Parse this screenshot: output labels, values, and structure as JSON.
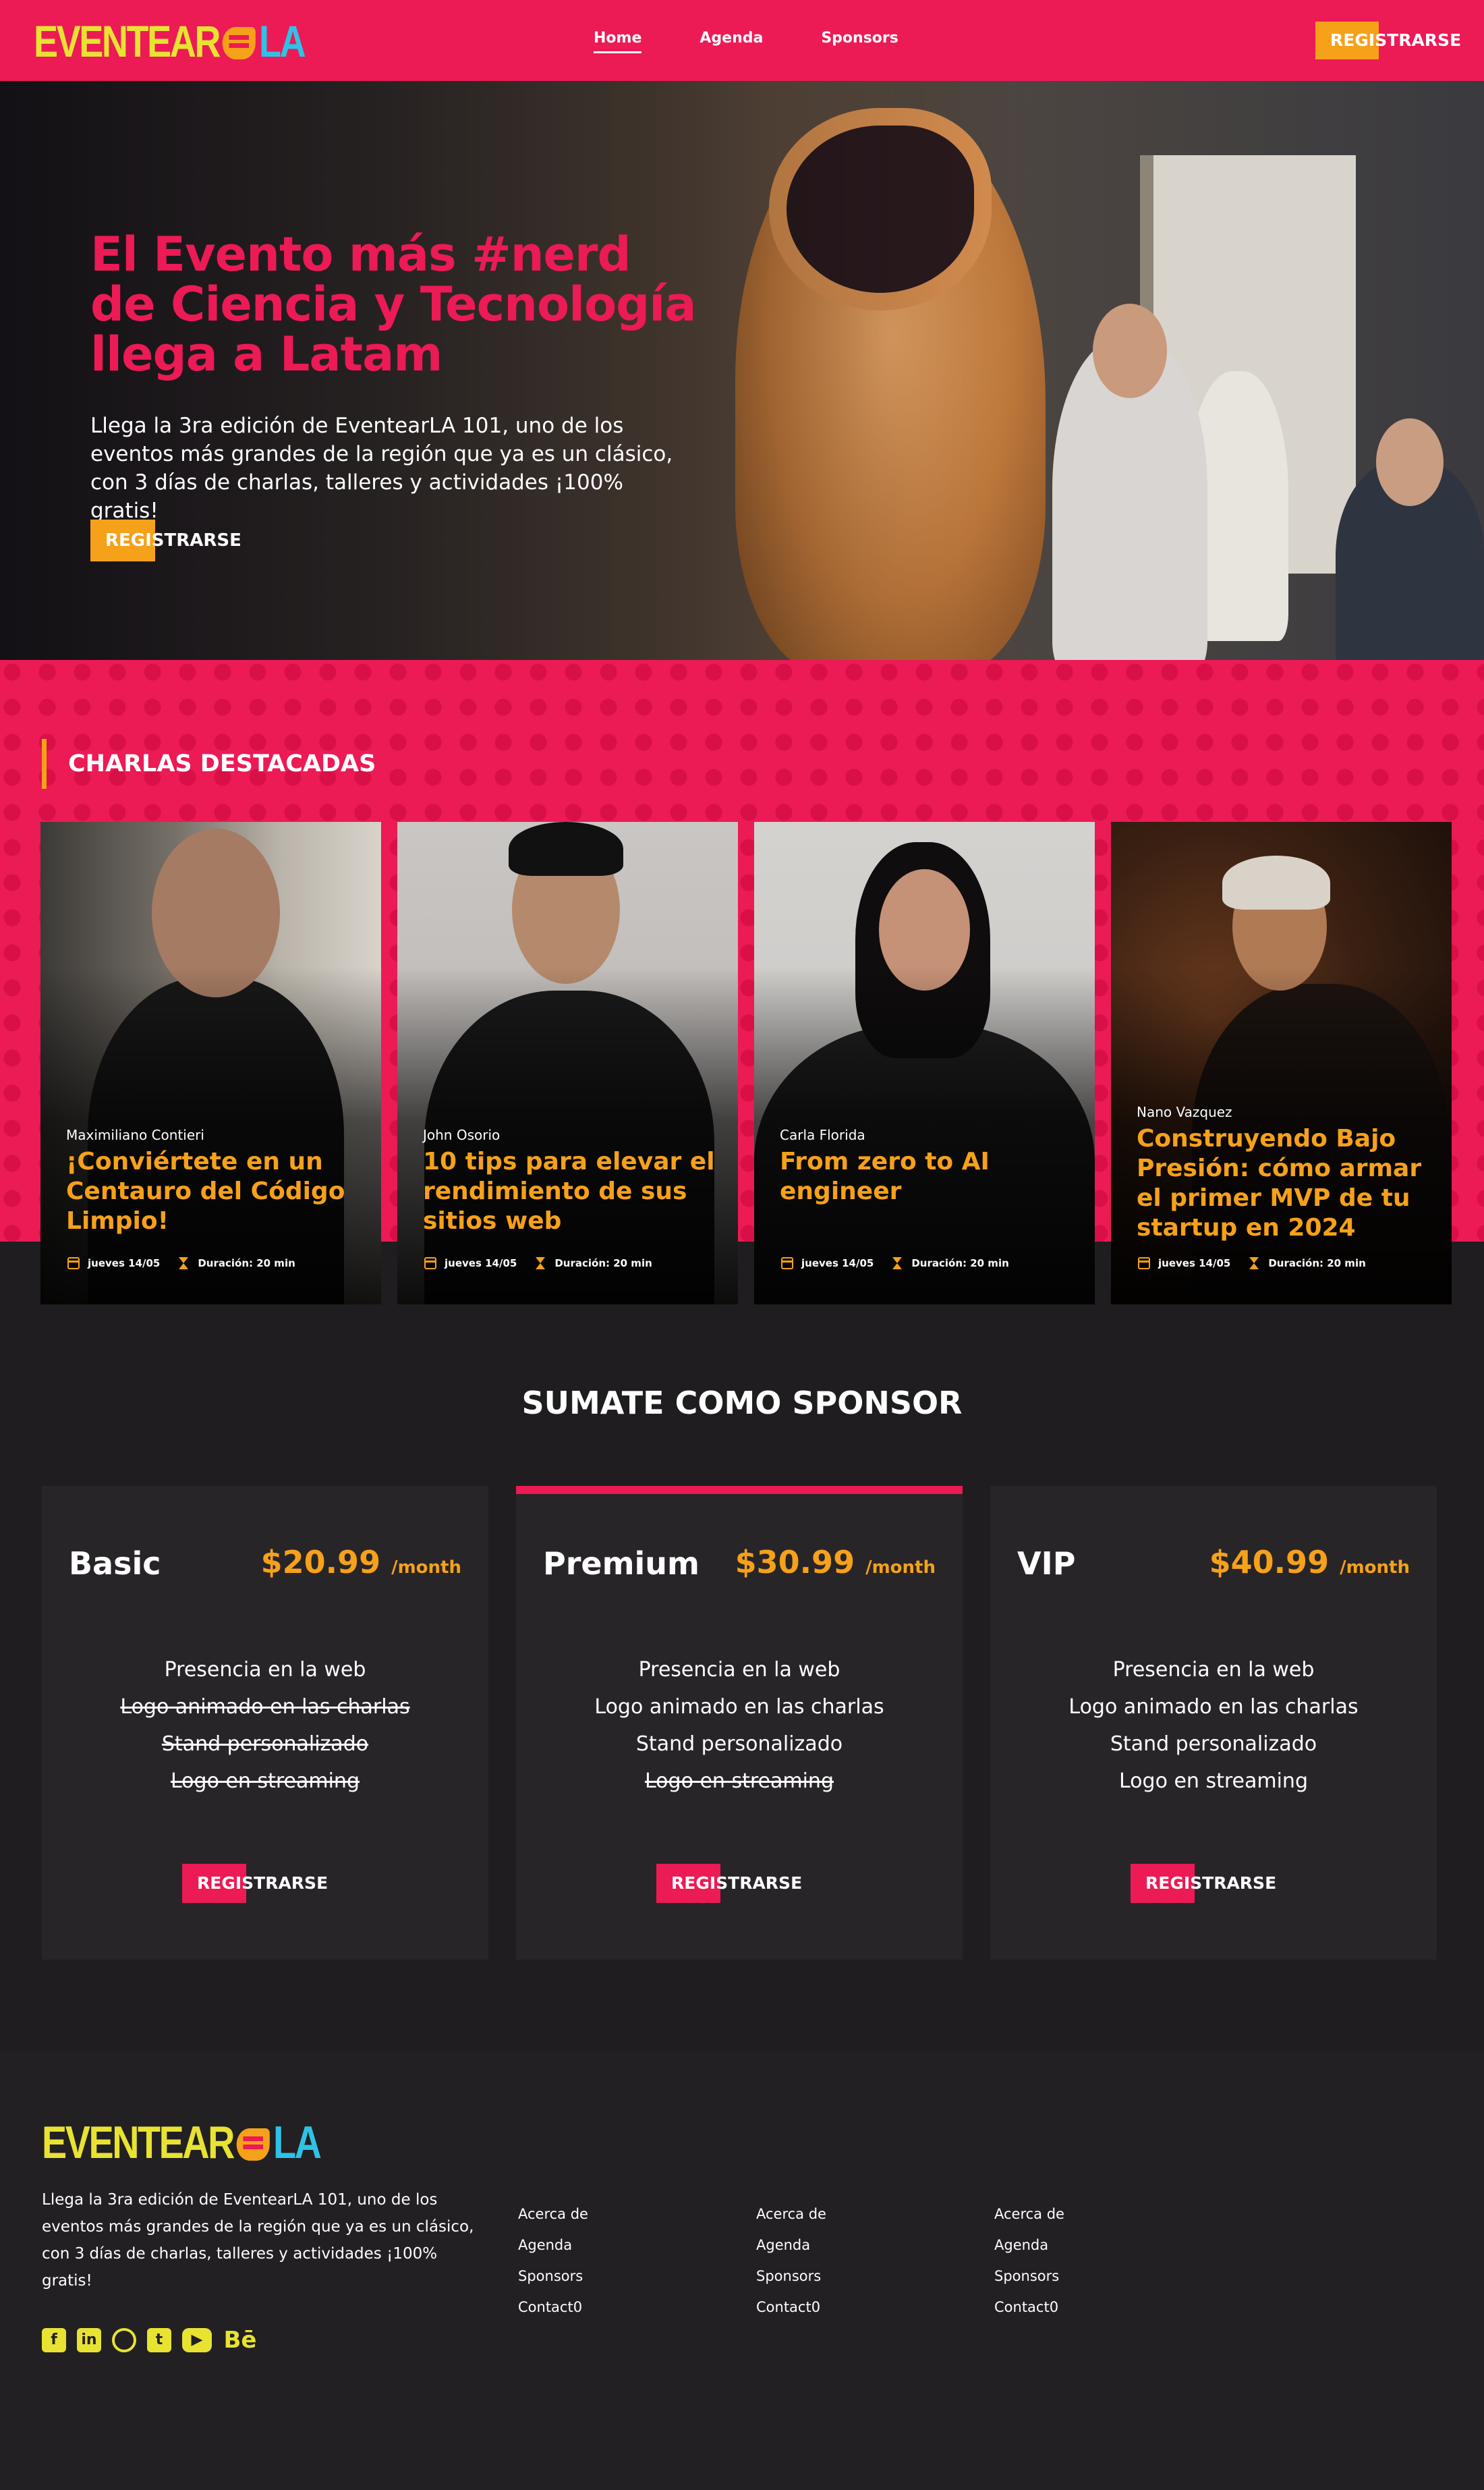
{
  "nav": {
    "logo_left": "EVENTEAR",
    "logo_right": "LA",
    "links": [
      "Home",
      "Agenda",
      "Sponsors"
    ],
    "register": "REGISTRARSE"
  },
  "hero": {
    "title": "El Evento más #nerd de Ciencia y Tecnología llega a Latam",
    "text": "Llega la 3ra edición de EventearLA 101, uno de los eventos más grandes de la región que ya es un clásico, con 3 días de charlas, talleres y actividades ¡100% gratis!",
    "register": "REGISTRARSE"
  },
  "charlas": {
    "heading": "CHARLAS DESTACADAS",
    "cards": [
      {
        "speaker": "Maximiliano Contieri",
        "title": "¡Conviértete en un Centauro del Código Limpio!",
        "date": "jueves 14/05",
        "duration": "Duración: 20 min"
      },
      {
        "speaker": "John Osorio",
        "title": "10 tips para elevar el rendimiento de sus sitios web",
        "date": "jueves 14/05",
        "duration": "Duración: 20 min"
      },
      {
        "speaker": "Carla Florida",
        "title": "From zero to AI engineer",
        "date": "jueves 14/05",
        "duration": "Duración: 20 min"
      },
      {
        "speaker": "Nano Vazquez",
        "title": "Construyendo Bajo Presión: cómo armar el primer MVP de tu startup en 2024",
        "date": "jueves 14/05",
        "duration": "Duración: 20 min"
      }
    ]
  },
  "sponsor": {
    "heading": "SUMATE COMO SPONSOR",
    "plans": [
      {
        "name": "Basic",
        "price": "$20.99",
        "period": "/month",
        "features": [
          "Presencia en la web",
          "Logo animado en las charlas",
          "Stand personalizado",
          "Logo en streaming"
        ],
        "register": "REGISTRARSE"
      },
      {
        "name": "Premium",
        "price": "$30.99",
        "period": "/month",
        "features": [
          "Presencia en la web",
          "Logo animado en las charlas",
          "Stand personalizado",
          "Logo en streaming"
        ],
        "register": "REGISTRARSE"
      },
      {
        "name": "VIP",
        "price": "$40.99",
        "period": "/month",
        "features": [
          "Presencia en la web",
          "Logo animado en las charlas",
          "Stand personalizado",
          "Logo en streaming"
        ],
        "register": "REGISTRARSE"
      }
    ]
  },
  "footer": {
    "logo_left": "EVENTEAR",
    "logo_right": "LA",
    "text": "Llega la 3ra edición de EventearLA 101, uno de los eventos más grandes de la región que ya es un clásico, con 3 días de charlas, talleres y actividades ¡100% gratis!",
    "columns": [
      [
        "Acerca de",
        "Agenda",
        "Sponsors",
        "Contact0"
      ],
      [
        "Acerca de",
        "Agenda",
        "Sponsors",
        "Contact0"
      ],
      [
        "Acerca de",
        "Agenda",
        "Sponsors",
        "Contact0"
      ]
    ],
    "socials": [
      "facebook-icon",
      "linkedin-icon",
      "instagram-icon",
      "twitter-icon",
      "youtube-icon",
      "behance-icon"
    ],
    "behance_glyph": "Bē"
  },
  "colors": {
    "brand_pink": "#ec1a55",
    "brand_orange": "#f6a11a",
    "logo_yellow": "#e8e233",
    "logo_blue": "#2ec3e6",
    "dark": "#1f1d1f"
  }
}
